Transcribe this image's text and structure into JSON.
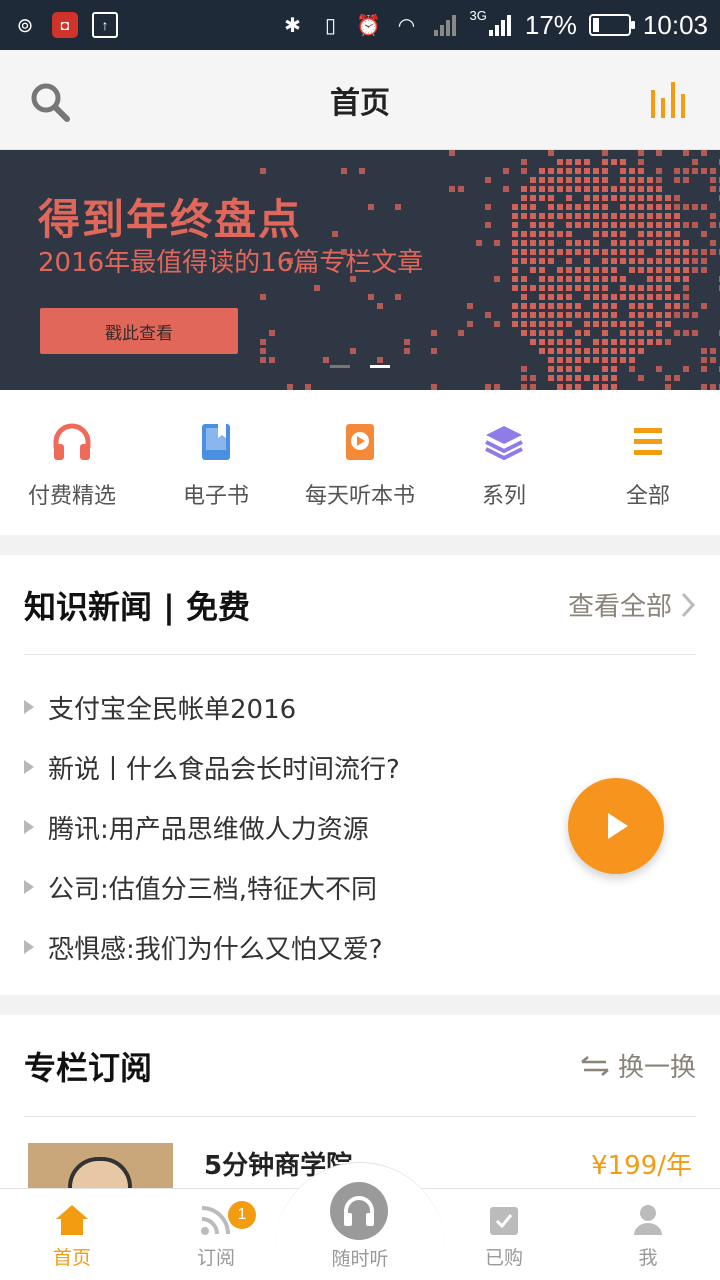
{
  "status_bar": {
    "network": "3G",
    "battery": "17%",
    "battery_level": 0.17,
    "time": "10:03"
  },
  "header": {
    "title": "首页"
  },
  "banner": {
    "headline": "得到年终盘点",
    "subline": "2016年最值得读的16篇专栏文章",
    "cta": "戳此查看",
    "page_index": 2,
    "page_count": 2
  },
  "categories": [
    {
      "label": "付费精选",
      "icon": "headphones-icon",
      "color": "#f06a5a"
    },
    {
      "label": "电子书",
      "icon": "book-icon",
      "color": "#4a90e2"
    },
    {
      "label": "每天听本书",
      "icon": "play-book-icon",
      "color": "#f5893a"
    },
    {
      "label": "系列",
      "icon": "layers-icon",
      "color": "#8f7ce8"
    },
    {
      "label": "全部",
      "icon": "menu-icon",
      "color": "#f39c12"
    }
  ],
  "news": {
    "title": "知识新闻 | 免费",
    "more": "查看全部",
    "items": [
      "支付宝全民帐单2016",
      "新说丨什么食品会长时间流行?",
      "腾讯:用产品思维做人力资源",
      "公司:估值分三档,特征大不同",
      "恐惧感:我们为什么又怕又爱?"
    ]
  },
  "columns": {
    "title": "专栏订阅",
    "swap": "换一换",
    "item": {
      "name": "5分钟商学院",
      "price": "¥199/年"
    }
  },
  "tabbar": {
    "tabs": [
      {
        "label": "首页",
        "icon": "home-icon"
      },
      {
        "label": "订阅",
        "icon": "rss-icon",
        "badge": "1"
      },
      {
        "label": "随时听",
        "icon": "headset-icon"
      },
      {
        "label": "已购",
        "icon": "purchased-icon"
      },
      {
        "label": "我",
        "icon": "user-icon"
      }
    ]
  },
  "colors": {
    "accent": "#f39c12",
    "banner_bg": "#2f3745",
    "banner_text": "#e2675b"
  }
}
